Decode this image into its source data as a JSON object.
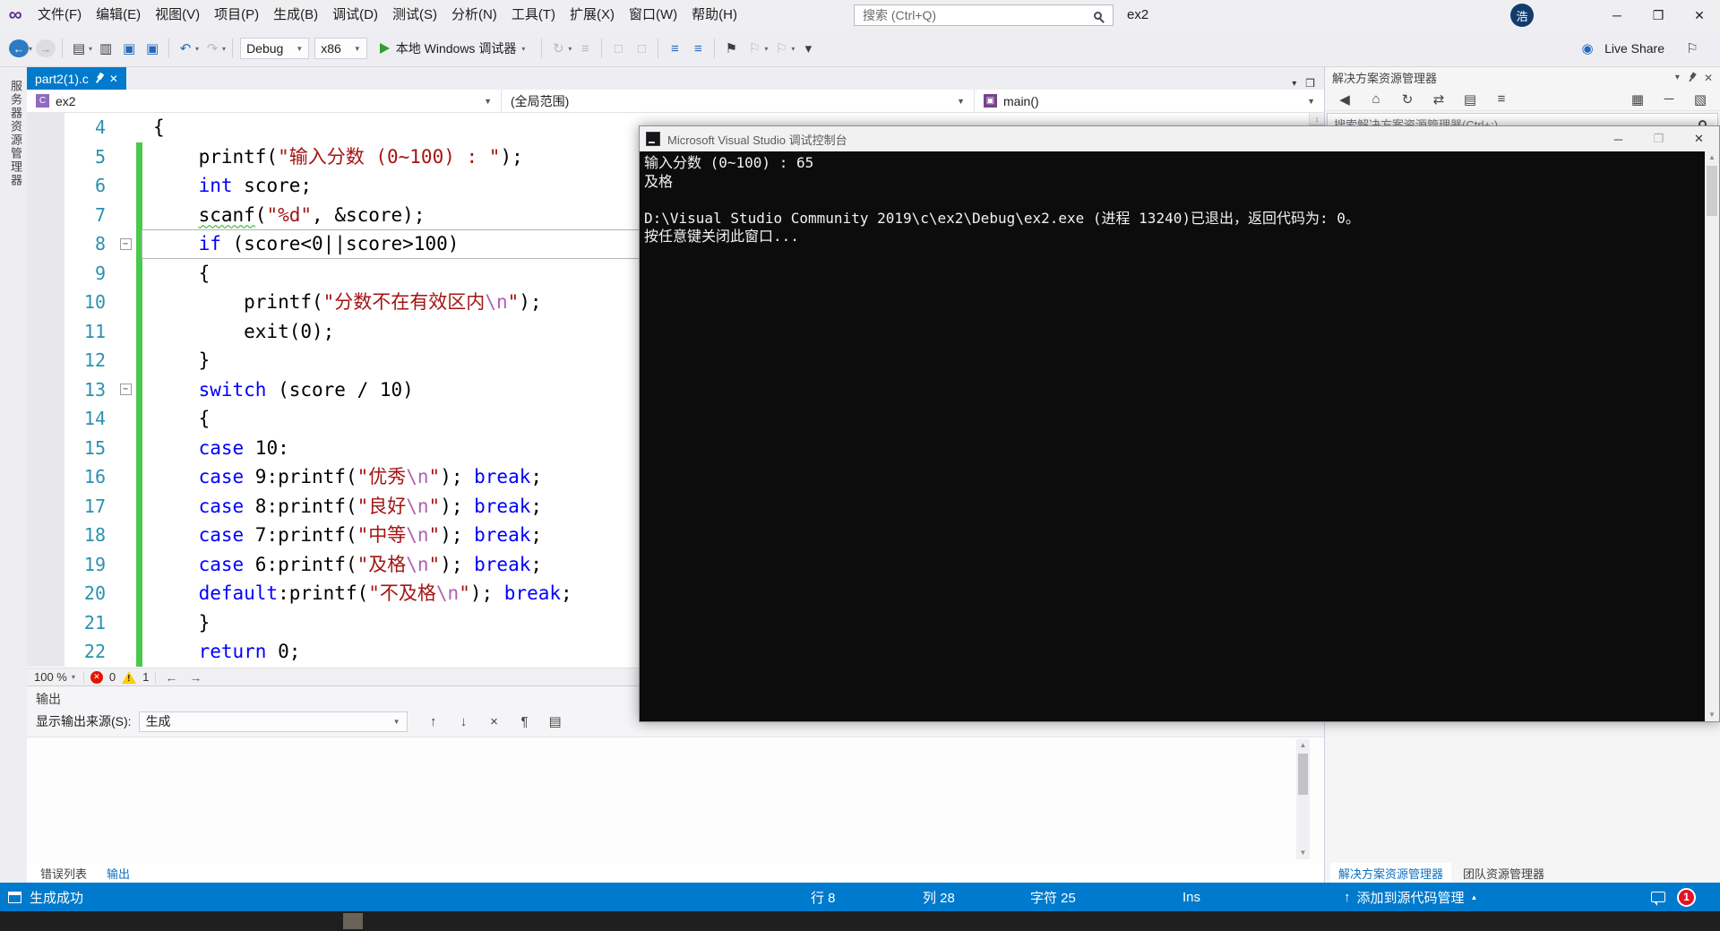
{
  "colors": {
    "accent_blue": "#007ACC",
    "keyword": "#0000FF",
    "string": "#A31515",
    "escape": "#B060B0",
    "line_number": "#2B91AF",
    "change_bar_green": "#4CC84C",
    "console_bg": "#0C0C0C",
    "start_green": "#2F9E2F",
    "error_red": "#E51400",
    "warning_yellow": "#FFCC00",
    "notification_red": "#E81123"
  },
  "titlebar": {
    "menus": [
      "文件(F)",
      "编辑(E)",
      "视图(V)",
      "项目(P)",
      "生成(B)",
      "调试(D)",
      "测试(S)",
      "分析(N)",
      "工具(T)",
      "扩展(X)",
      "窗口(W)",
      "帮助(H)"
    ],
    "search_placeholder": "搜索 (Ctrl+Q)",
    "solution_name": "ex2",
    "avatar_text": "浩"
  },
  "toolbar": {
    "configuration": "Debug",
    "platform": "x86",
    "start_debug_label": "本地 Windows 调试器",
    "live_share_label": "Live Share"
  },
  "editor": {
    "tab_title": "part2(1).c",
    "nav_project": "ex2",
    "nav_scope": "(全局范围)",
    "nav_member": "main()",
    "zoom": "100 %",
    "error_count": "0",
    "warning_count": "1"
  },
  "code_lines": [
    {
      "n": "4",
      "g": false,
      "f": false,
      "cur": false,
      "segs": [
        [
          "p",
          "{"
        ]
      ]
    },
    {
      "n": "5",
      "g": true,
      "f": false,
      "cur": false,
      "segs": [
        [
          "p",
          "    printf("
        ],
        [
          "s",
          "\"输入分数 (0~100) : \""
        ],
        [
          "p",
          ");"
        ]
      ]
    },
    {
      "n": "6",
      "g": true,
      "f": false,
      "cur": false,
      "segs": [
        [
          "p",
          "    "
        ],
        [
          "k",
          "int"
        ],
        [
          "p",
          " score;"
        ]
      ]
    },
    {
      "n": "7",
      "g": true,
      "f": false,
      "cur": false,
      "segs": [
        [
          "p",
          "    "
        ],
        [
          "w",
          "scanf"
        ],
        [
          "p",
          "("
        ],
        [
          "s",
          "\"%d\""
        ],
        [
          "p",
          ", &score);"
        ]
      ]
    },
    {
      "n": "8",
      "g": true,
      "f": true,
      "cur": true,
      "segs": [
        [
          "p",
          "    "
        ],
        [
          "k",
          "if"
        ],
        [
          "p",
          " (score<0||score>100)"
        ]
      ]
    },
    {
      "n": "9",
      "g": true,
      "f": false,
      "cur": false,
      "segs": [
        [
          "p",
          "    {"
        ]
      ]
    },
    {
      "n": "10",
      "g": true,
      "f": false,
      "cur": false,
      "segs": [
        [
          "p",
          "        printf("
        ],
        [
          "s",
          "\"分数不在有效区内"
        ],
        [
          "e",
          "\\n"
        ],
        [
          "s",
          "\""
        ],
        [
          "p",
          ");"
        ]
      ]
    },
    {
      "n": "11",
      "g": true,
      "f": false,
      "cur": false,
      "segs": [
        [
          "p",
          "        exit(0);"
        ]
      ]
    },
    {
      "n": "12",
      "g": true,
      "f": false,
      "cur": false,
      "segs": [
        [
          "p",
          "    }"
        ]
      ]
    },
    {
      "n": "13",
      "g": true,
      "f": true,
      "cur": false,
      "segs": [
        [
          "p",
          "    "
        ],
        [
          "k",
          "switch"
        ],
        [
          "p",
          " (score / 10)"
        ]
      ]
    },
    {
      "n": "14",
      "g": true,
      "f": false,
      "cur": false,
      "segs": [
        [
          "p",
          "    {"
        ]
      ]
    },
    {
      "n": "15",
      "g": true,
      "f": false,
      "cur": false,
      "segs": [
        [
          "p",
          "    "
        ],
        [
          "k",
          "case"
        ],
        [
          "p",
          " 10:"
        ]
      ]
    },
    {
      "n": "16",
      "g": true,
      "f": false,
      "cur": false,
      "segs": [
        [
          "p",
          "    "
        ],
        [
          "k",
          "case"
        ],
        [
          "p",
          " 9:printf("
        ],
        [
          "s",
          "\"优秀"
        ],
        [
          "e",
          "\\n"
        ],
        [
          "s",
          "\""
        ],
        [
          "p",
          "); "
        ],
        [
          "k",
          "break"
        ],
        [
          "p",
          ";"
        ]
      ]
    },
    {
      "n": "17",
      "g": true,
      "f": false,
      "cur": false,
      "segs": [
        [
          "p",
          "    "
        ],
        [
          "k",
          "case"
        ],
        [
          "p",
          " 8:printf("
        ],
        [
          "s",
          "\"良好"
        ],
        [
          "e",
          "\\n"
        ],
        [
          "s",
          "\""
        ],
        [
          "p",
          "); "
        ],
        [
          "k",
          "break"
        ],
        [
          "p",
          ";"
        ]
      ]
    },
    {
      "n": "18",
      "g": true,
      "f": false,
      "cur": false,
      "segs": [
        [
          "p",
          "    "
        ],
        [
          "k",
          "case"
        ],
        [
          "p",
          " 7:printf("
        ],
        [
          "s",
          "\"中等"
        ],
        [
          "e",
          "\\n"
        ],
        [
          "s",
          "\""
        ],
        [
          "p",
          "); "
        ],
        [
          "k",
          "break"
        ],
        [
          "p",
          ";"
        ]
      ]
    },
    {
      "n": "19",
      "g": true,
      "f": false,
      "cur": false,
      "segs": [
        [
          "p",
          "    "
        ],
        [
          "k",
          "case"
        ],
        [
          "p",
          " 6:printf("
        ],
        [
          "s",
          "\"及格"
        ],
        [
          "e",
          "\\n"
        ],
        [
          "s",
          "\""
        ],
        [
          "p",
          "); "
        ],
        [
          "k",
          "break"
        ],
        [
          "p",
          ";"
        ]
      ]
    },
    {
      "n": "20",
      "g": true,
      "f": false,
      "cur": false,
      "segs": [
        [
          "p",
          "    "
        ],
        [
          "k",
          "default"
        ],
        [
          "p",
          ":printf("
        ],
        [
          "s",
          "\"不及格"
        ],
        [
          "e",
          "\\n"
        ],
        [
          "s",
          "\""
        ],
        [
          "p",
          "); "
        ],
        [
          "k",
          "break"
        ],
        [
          "p",
          ";"
        ]
      ]
    },
    {
      "n": "21",
      "g": true,
      "f": false,
      "cur": false,
      "segs": [
        [
          "p",
          "    }"
        ]
      ]
    },
    {
      "n": "22",
      "g": true,
      "f": false,
      "cur": false,
      "segs": [
        [
          "p",
          "    "
        ],
        [
          "k",
          "return"
        ],
        [
          "p",
          " 0;"
        ]
      ]
    }
  ],
  "console": {
    "title": "Microsoft Visual Studio 调试控制台",
    "lines": [
      "输入分数 (0~100) : 65",
      "及格",
      "",
      "D:\\Visual Studio Community 2019\\c\\ex2\\Debug\\ex2.exe (进程 13240)已退出，返回代码为: 0。",
      "按任意键关闭此窗口..."
    ]
  },
  "solution_explorer": {
    "title": "解决方案资源管理器",
    "search_placeholder": "搜索解决方案资源管理器(Ctrl+;)"
  },
  "output_panel": {
    "title": "输出",
    "source_label": "显示输出来源(S):",
    "source_value": "生成"
  },
  "panel_tabs": {
    "left": [
      "错误列表",
      "输出"
    ],
    "left_active": "输出",
    "right": [
      "解决方案资源管理器",
      "团队资源管理器"
    ],
    "right_active": "解决方案资源管理器"
  },
  "statusbar": {
    "message": "生成成功",
    "line": "行 8",
    "column": "列 28",
    "character": "字符 25",
    "insert_mode": "Ins",
    "source_control": "添加到源代码管理",
    "notification_count": "1"
  },
  "left_strip": {
    "vertical_tab": "服务器资源管理器"
  },
  "icons": {
    "main_toolbar_left": [
      {
        "name": "navigate-back-icon",
        "glyph": "←",
        "cls": "circ blue",
        "caret": true
      },
      {
        "name": "navigate-forward-icon",
        "glyph": "→",
        "cls": "circ dis"
      },
      {
        "sep": true
      },
      {
        "name": "new-project-icon",
        "glyph": "▤",
        "cls": "dark",
        "caret": true
      },
      {
        "name": "open-file-icon",
        "glyph": "▥",
        "cls": "dark"
      },
      {
        "name": "save-icon",
        "glyph": "▣",
        "cls": "blue-ic"
      },
      {
        "name": "save-all-icon",
        "glyph": "▣",
        "cls": "blue-ic"
      },
      {
        "sep": true
      },
      {
        "name": "undo-icon",
        "glyph": "↶",
        "cls": "blue-ic",
        "caret": true
      },
      {
        "name": "redo-icon",
        "glyph": "↷",
        "cls": "dis",
        "caret": true
      },
      {
        "sep": true
      }
    ],
    "main_toolbar_mid": [
      {
        "sep": true
      },
      {
        "name": "hot-reload-icon",
        "glyph": "↻",
        "cls": "dis",
        "caret": true
      },
      {
        "name": "list-members-icon",
        "glyph": "≡",
        "cls": "dis"
      },
      {
        "sep": true
      },
      {
        "name": "breakpoints-window-icon",
        "glyph": "□",
        "cls": "dis"
      },
      {
        "name": "immediate-window-icon",
        "glyph": "□",
        "cls": "dis"
      },
      {
        "sep": true
      },
      {
        "name": "decrease-indent-icon",
        "glyph": "≡",
        "cls": "blue-ic"
      },
      {
        "name": "increase-indent-icon",
        "glyph": "≡",
        "cls": "blue-ic"
      },
      {
        "sep": true
      },
      {
        "name": "bookmark-icon",
        "glyph": "⚑",
        "cls": "dark"
      },
      {
        "name": "previous-bookmark-icon",
        "glyph": "⚐",
        "cls": "dis",
        "caret": true
      },
      {
        "name": "next-bookmark-icon",
        "glyph": "⚐",
        "cls": "dis",
        "caret": true
      },
      {
        "name": "toolbar-overflow-icon",
        "glyph": "▾",
        "cls": "dark"
      }
    ],
    "se_toolbar": [
      {
        "name": "se-back-icon",
        "glyph": "◀"
      },
      {
        "name": "home-icon",
        "glyph": "⌂"
      },
      {
        "name": "refresh-icon",
        "glyph": "↻"
      },
      {
        "name": "switch-views-icon",
        "glyph": "⇄"
      },
      {
        "name": "pending-changes-filter-icon",
        "glyph": "▤"
      },
      {
        "name": "sync-with-active-document-icon",
        "glyph": "≡"
      },
      {
        "spacer": true
      },
      {
        "name": "show-all-files-icon",
        "glyph": "▦"
      },
      {
        "name": "collapse-all-icon",
        "glyph": "─"
      },
      {
        "name": "properties-icon",
        "glyph": "▧"
      }
    ],
    "output_toolbar": [
      {
        "name": "goto-previous-message-icon",
        "glyph": "↑"
      },
      {
        "name": "goto-next-message-icon",
        "glyph": "↓"
      },
      {
        "name": "clear-all-output-icon",
        "glyph": "×"
      },
      {
        "name": "word-wrap-icon",
        "glyph": "¶"
      },
      {
        "name": "toggle-output-window-icon",
        "glyph": "▤"
      }
    ]
  }
}
